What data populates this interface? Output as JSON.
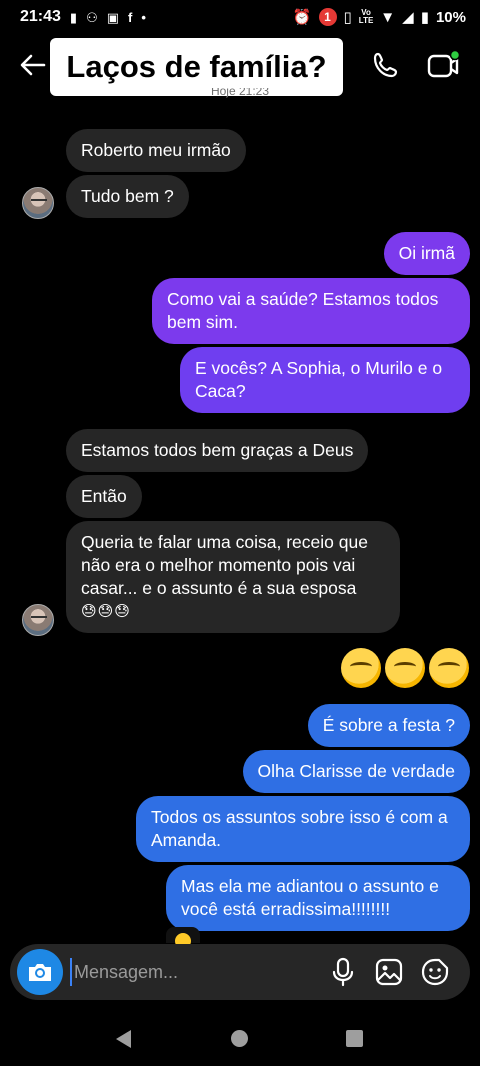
{
  "status_bar": {
    "time": "21:43",
    "notification_count": "1",
    "network_top": "Vo",
    "network_bottom": "LTE",
    "battery": "10%"
  },
  "header": {
    "title": "Laços de família?",
    "timestamp_peek": "Hoje 21:23"
  },
  "messages": [
    {
      "side": "in",
      "text": "Roberto meu irmão"
    },
    {
      "side": "in",
      "text": "Tudo bem ?"
    },
    {
      "side": "out",
      "text": "Oi irmã"
    },
    {
      "side": "out",
      "text": "Como vai a saúde? Estamos todos bem sim."
    },
    {
      "side": "out",
      "text": "E vocês? A Sophia, o Murilo e o Caca?"
    },
    {
      "side": "in",
      "text": "Estamos todos bem graças a Deus"
    },
    {
      "side": "in",
      "text": "Então"
    },
    {
      "side": "in",
      "text": "Queria te falar uma coisa, receio que não era o melhor momento pois vai casar... e o assunto é a sua esposa",
      "emojis": "😓😓😓"
    },
    {
      "side": "out",
      "text": "🤔🤔🤔"
    },
    {
      "side": "out",
      "text": "É sobre a festa ?"
    },
    {
      "side": "out",
      "text": "Olha Clarisse de verdade"
    },
    {
      "side": "out",
      "text": "Todos os assuntos sobre isso é com a Amanda."
    },
    {
      "side": "out",
      "text": "Mas ela me adiantou o assunto e você está erradissima!!!!!!!!"
    }
  ],
  "composer": {
    "placeholder": "Mensagem..."
  },
  "icons": {
    "back": "arrow-left-icon",
    "call": "phone-icon",
    "video": "video-camera-icon",
    "camera": "camera-icon",
    "mic": "microphone-icon",
    "gallery": "image-icon",
    "sticker": "sticker-icon"
  },
  "colors": {
    "incoming_bubble": "#262626",
    "outgoing_purple": "#7c3aed",
    "outgoing_blue": "#2f6fe4",
    "accent_blue": "#1e88e5",
    "online_dot": "#2ecc40"
  }
}
